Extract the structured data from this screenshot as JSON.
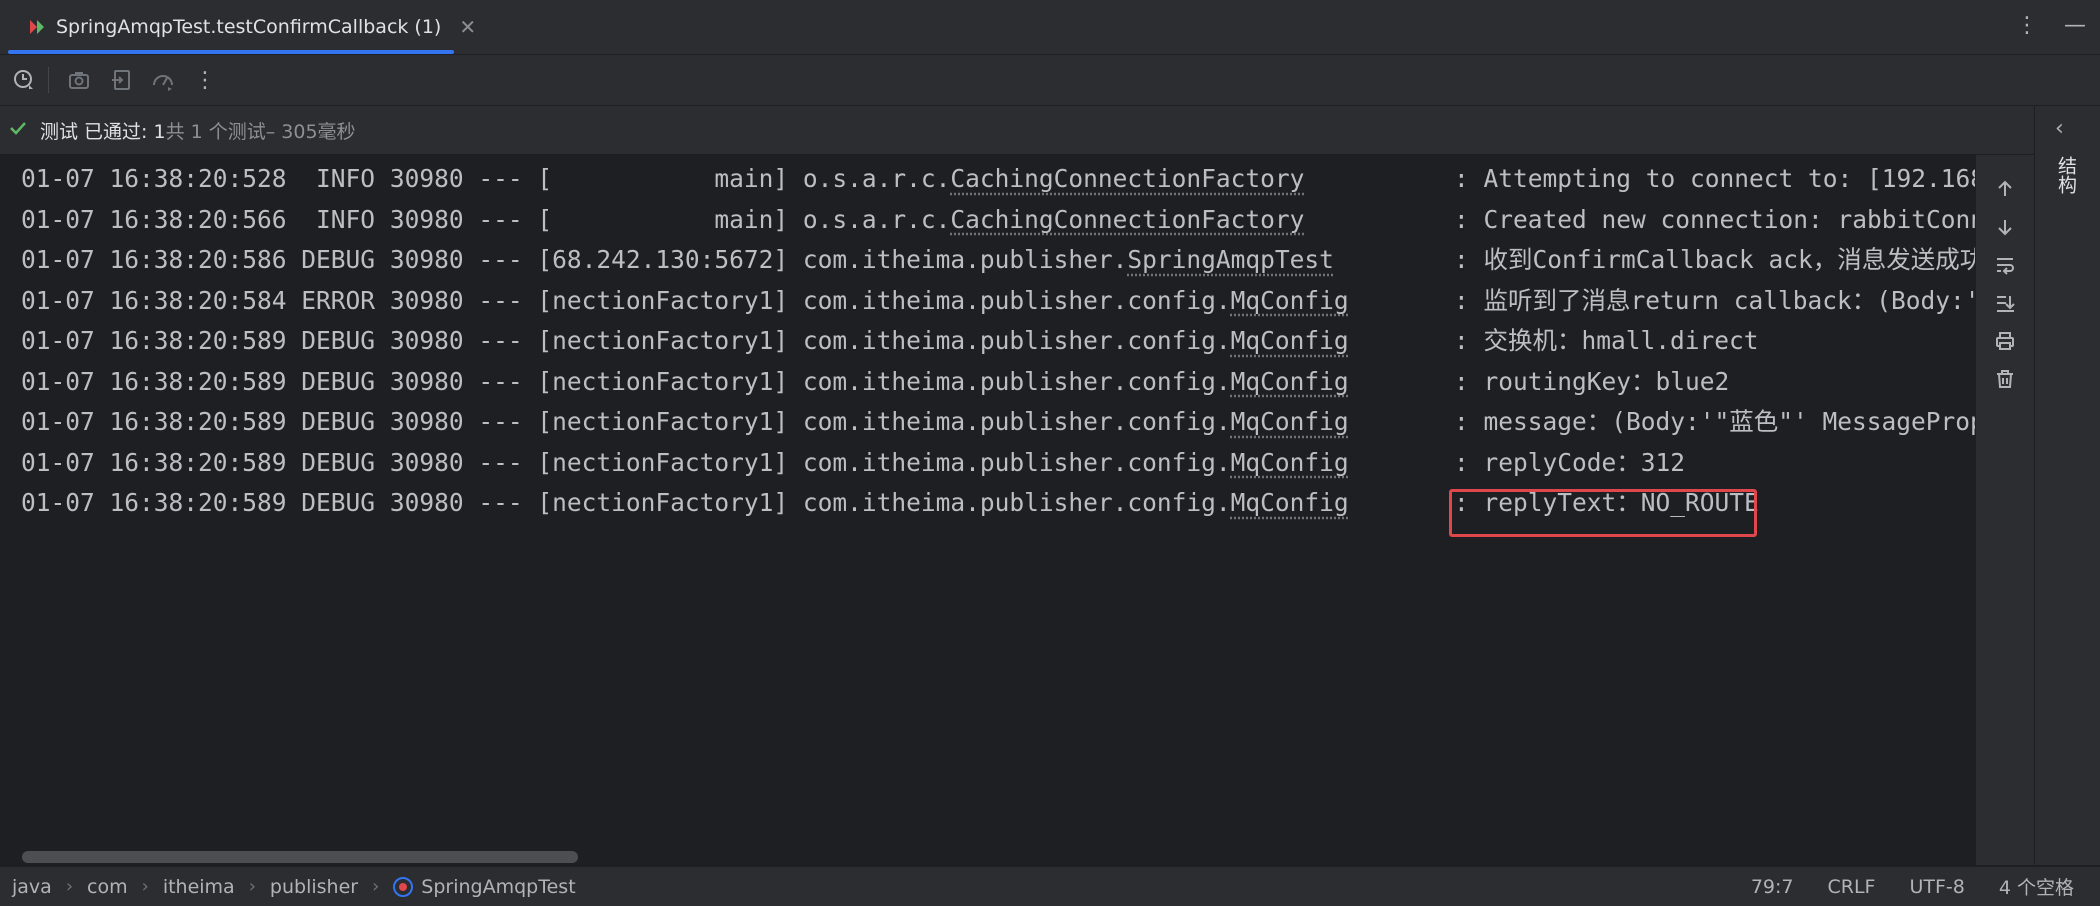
{
  "tab": {
    "title": "SpringAmqpTest.testConfirmCallback (1)",
    "close": "✕"
  },
  "tabbar_right": {
    "more": "⋮",
    "minimize": "—"
  },
  "toolbar": {
    "more": "⋮"
  },
  "status": {
    "passed_label": "测试 已通过: 1",
    "total": "共 1 个测试",
    "duration": " – 305毫秒"
  },
  "log": [
    {
      "date": "01-07 16:38:20:528",
      "level": " INFO",
      "pid": "30980",
      "sep": "---",
      "thread": "[           main]",
      "pkg": "o.s.a.r.c.",
      "cls": "CachingConnectionFactory",
      "pad": "      ",
      "msg": ": Attempting to connect to: [192.168"
    },
    {
      "date": "01-07 16:38:20:566",
      "level": " INFO",
      "pid": "30980",
      "sep": "---",
      "thread": "[           main]",
      "pkg": "o.s.a.r.c.",
      "cls": "CachingConnectionFactory",
      "pad": "      ",
      "msg": ": Created new connection: rabbitConne"
    },
    {
      "date": "01-07 16:38:20:586",
      "level": "DEBUG",
      "pid": "30980",
      "sep": "---",
      "thread": "[68.242.130:5672]",
      "pkg": "com.itheima.publisher.",
      "cls": "SpringAmqpTest",
      "pad": "    ",
      "msg": ": 收到ConfirmCallback ack，消息发送成功"
    },
    {
      "date": "01-07 16:38:20:584",
      "level": "ERROR",
      "pid": "30980",
      "sep": "---",
      "thread": "[nectionFactory1]",
      "pkg": "com.itheima.publisher.config.",
      "cls": "MqConfig",
      "pad": "    ",
      "msg": ": 监听到了消息return callback：(Body:'"
    },
    {
      "date": "01-07 16:38:20:589",
      "level": "DEBUG",
      "pid": "30980",
      "sep": "---",
      "thread": "[nectionFactory1]",
      "pkg": "com.itheima.publisher.config.",
      "cls": "MqConfig",
      "pad": "    ",
      "msg": ": 交换机：hmall.direct"
    },
    {
      "date": "01-07 16:38:20:589",
      "level": "DEBUG",
      "pid": "30980",
      "sep": "---",
      "thread": "[nectionFactory1]",
      "pkg": "com.itheima.publisher.config.",
      "cls": "MqConfig",
      "pad": "    ",
      "msg": ": routingKey：blue2"
    },
    {
      "date": "01-07 16:38:20:589",
      "level": "DEBUG",
      "pid": "30980",
      "sep": "---",
      "thread": "[nectionFactory1]",
      "pkg": "com.itheima.publisher.config.",
      "cls": "MqConfig",
      "pad": "    ",
      "msg": ": message：(Body:'\"蓝色\"' MessageProp"
    },
    {
      "date": "01-07 16:38:20:589",
      "level": "DEBUG",
      "pid": "30980",
      "sep": "---",
      "thread": "[nectionFactory1]",
      "pkg": "com.itheima.publisher.config.",
      "cls": "MqConfig",
      "pad": "    ",
      "msg": ": replyCode：312"
    },
    {
      "date": "01-07 16:38:20:589",
      "level": "DEBUG",
      "pid": "30980",
      "sep": "---",
      "thread": "[nectionFactory1]",
      "pkg": "com.itheima.publisher.config.",
      "cls": "MqConfig",
      "pad": "    ",
      "msg": ": replyText：NO_ROUTE"
    }
  ],
  "side_panel": {
    "label": "结构",
    "chevron": "‹"
  },
  "breadcrumb": [
    "java",
    "com",
    "itheima",
    "publisher",
    "SpringAmqpTest"
  ],
  "statusbar": {
    "position": "79:7",
    "line_ending": "CRLF",
    "encoding": "UTF-8",
    "indent": "4 个空格"
  },
  "colors": {
    "accent": "#3574f0",
    "success": "#5fb865",
    "highlight": "#e0474c",
    "background": "#1e1f22"
  }
}
